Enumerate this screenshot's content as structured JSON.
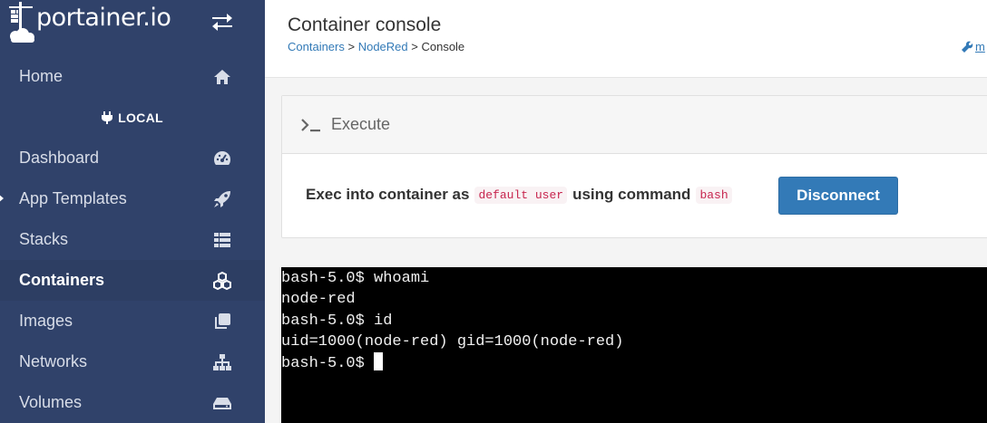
{
  "brand": {
    "name": "portainer.io"
  },
  "sidebar": {
    "home_label": "Home",
    "endpoint_label": "LOCAL",
    "items": [
      {
        "label": "Dashboard",
        "icon": "dashboard-icon"
      },
      {
        "label": "App Templates",
        "icon": "rocket-icon"
      },
      {
        "label": "Stacks",
        "icon": "th-list-icon"
      },
      {
        "label": "Containers",
        "icon": "cubes-icon"
      },
      {
        "label": "Images",
        "icon": "clone-icon"
      },
      {
        "label": "Networks",
        "icon": "sitemap-icon"
      },
      {
        "label": "Volumes",
        "icon": "hdd-icon"
      }
    ],
    "active": "Containers"
  },
  "header": {
    "title": "Container console",
    "breadcrumb": {
      "containers": "Containers",
      "sep1": " > ",
      "container": "NodeRed",
      "sep2": " > ",
      "current": "Console"
    },
    "user_link": "m"
  },
  "widget": {
    "title": "Execute",
    "exec_prefix": "Exec into container as",
    "user": "default user",
    "cmd_prefix": "using command",
    "command": "bash",
    "button_label": "Disconnect"
  },
  "terminal": {
    "lines": [
      "bash-5.0$ whoami",
      "node-red",
      "bash-5.0$ id",
      "uid=1000(node-red) gid=1000(node-red)",
      "bash-5.0$"
    ]
  },
  "colors": {
    "sidebar_bg": "#30426a",
    "primary": "#337ab7",
    "code_text": "#c7254e",
    "terminal_bg": "#000000"
  }
}
